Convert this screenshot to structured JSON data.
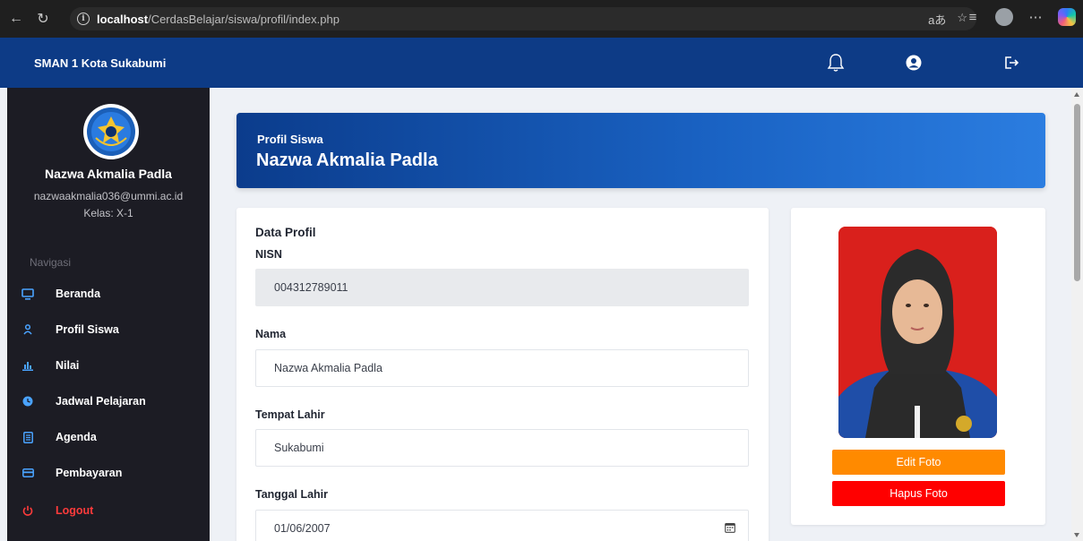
{
  "browser": {
    "url_host": "localhost",
    "url_path": "/CerdasBelajar/siswa/profil/index.php",
    "read_aloud_label": "aあ"
  },
  "topbar": {
    "brand": "SMAN 1 Kota Sukabumi"
  },
  "sidebar": {
    "name": "Nazwa Akmalia Padla",
    "email": "nazwaakmalia036@ummi.ac.id",
    "class_label": "Kelas: X-1",
    "nav_heading": "Navigasi",
    "items": [
      {
        "label": "Beranda",
        "icon": "monitor-icon"
      },
      {
        "label": "Profil Siswa",
        "icon": "user-icon"
      },
      {
        "label": "Nilai",
        "icon": "chart-icon"
      },
      {
        "label": "Jadwal Pelajaran",
        "icon": "clock-icon"
      },
      {
        "label": "Agenda",
        "icon": "document-icon"
      },
      {
        "label": "Pembayaran",
        "icon": "card-icon"
      },
      {
        "label": "Logout",
        "icon": "power-icon"
      }
    ]
  },
  "banner": {
    "subtitle": "Profil Siswa",
    "title": "Nazwa Akmalia Padla"
  },
  "form": {
    "section_title": "Data Profil",
    "fields": [
      {
        "label": "NISN",
        "value": "004312789011"
      },
      {
        "label": "Nama",
        "value": "Nazwa Akmalia Padla"
      },
      {
        "label": "Tempat Lahir",
        "value": "Sukabumi"
      },
      {
        "label": "Tanggal Lahir",
        "value": "01/06/2007"
      }
    ]
  },
  "photo_card": {
    "edit_label": "Edit Foto",
    "delete_label": "Hapus Foto"
  },
  "colors": {
    "topbar": "#0d3b86",
    "sidebar": "#1c1c24",
    "edit_button": "#ff8a00",
    "delete_button": "#ff0000",
    "nav_icon": "#4aa3ff",
    "logout": "#ff3b3b"
  }
}
